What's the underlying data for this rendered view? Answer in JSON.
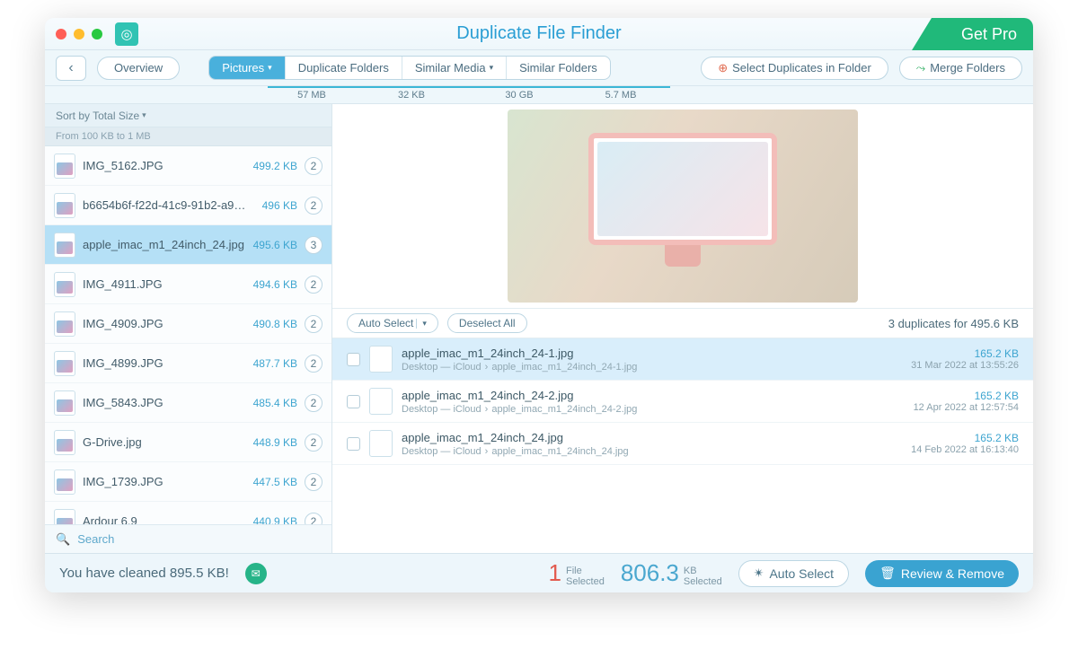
{
  "app": {
    "title": "Duplicate File Finder",
    "get_pro": "Get Pro"
  },
  "toolbar": {
    "back": "‹",
    "overview": "Overview",
    "tabs": [
      {
        "label": "Pictures",
        "size": "57 MB",
        "active": true,
        "has_caret": true
      },
      {
        "label": "Duplicate Folders",
        "size": "32 KB",
        "active": false,
        "has_caret": false
      },
      {
        "label": "Similar Media",
        "size": "30 GB",
        "active": false,
        "has_caret": true
      },
      {
        "label": "Similar Folders",
        "size": "5.7 MB",
        "active": false,
        "has_caret": false
      }
    ],
    "select_in_folder": "Select Duplicates in Folder",
    "merge_folders": "Merge Folders"
  },
  "sort": {
    "label": "Sort by Total Size"
  },
  "filter": {
    "label": "From 100 KB to 1 MB"
  },
  "sidebar": {
    "items": [
      {
        "name": "IMG_5162.JPG",
        "size": "499.2 KB",
        "count": "2"
      },
      {
        "name": "b6654b6f-f22d-41c9-91b2-a9…",
        "size": "496 KB",
        "count": "2"
      },
      {
        "name": "apple_imac_m1_24inch_24.jpg",
        "size": "495.6 KB",
        "count": "3"
      },
      {
        "name": "IMG_4911.JPG",
        "size": "494.6 KB",
        "count": "2"
      },
      {
        "name": "IMG_4909.JPG",
        "size": "490.8 KB",
        "count": "2"
      },
      {
        "name": "IMG_4899.JPG",
        "size": "487.7 KB",
        "count": "2"
      },
      {
        "name": "IMG_5843.JPG",
        "size": "485.4 KB",
        "count": "2"
      },
      {
        "name": "G-Drive.jpg",
        "size": "448.9 KB",
        "count": "2"
      },
      {
        "name": "IMG_1739.JPG",
        "size": "447.5 KB",
        "count": "2"
      },
      {
        "name": "Ardour 6.9",
        "size": "440.9 KB",
        "count": "2"
      }
    ],
    "search": "Search"
  },
  "duplicates": {
    "auto_select": "Auto Select",
    "deselect_all": "Deselect All",
    "summary": "3 duplicates for 495.6 KB",
    "path_sep": "›",
    "path_root": "Desktop — iCloud",
    "rows": [
      {
        "name": "apple_imac_m1_24inch_24-1.jpg",
        "leaf": "apple_imac_m1_24inch_24-1.jpg",
        "size": "165.2 KB",
        "date": "31 Mar 2022 at 13:55:26"
      },
      {
        "name": "apple_imac_m1_24inch_24-2.jpg",
        "leaf": "apple_imac_m1_24inch_24-2.jpg",
        "size": "165.2 KB",
        "date": "12 Apr 2022 at 12:57:54"
      },
      {
        "name": "apple_imac_m1_24inch_24.jpg",
        "leaf": "apple_imac_m1_24inch_24.jpg",
        "size": "165.2 KB",
        "date": "14 Feb 2022 at 16:13:40"
      }
    ]
  },
  "status": {
    "cleaned": "You have cleaned 895.5 KB!",
    "files_num": "1",
    "files_l1": "File",
    "files_l2": "Selected",
    "kb_num": "806.3",
    "kb_l1": "KB",
    "kb_l2": "Selected",
    "auto_select": "Auto Select",
    "review": "Review & Remove"
  }
}
